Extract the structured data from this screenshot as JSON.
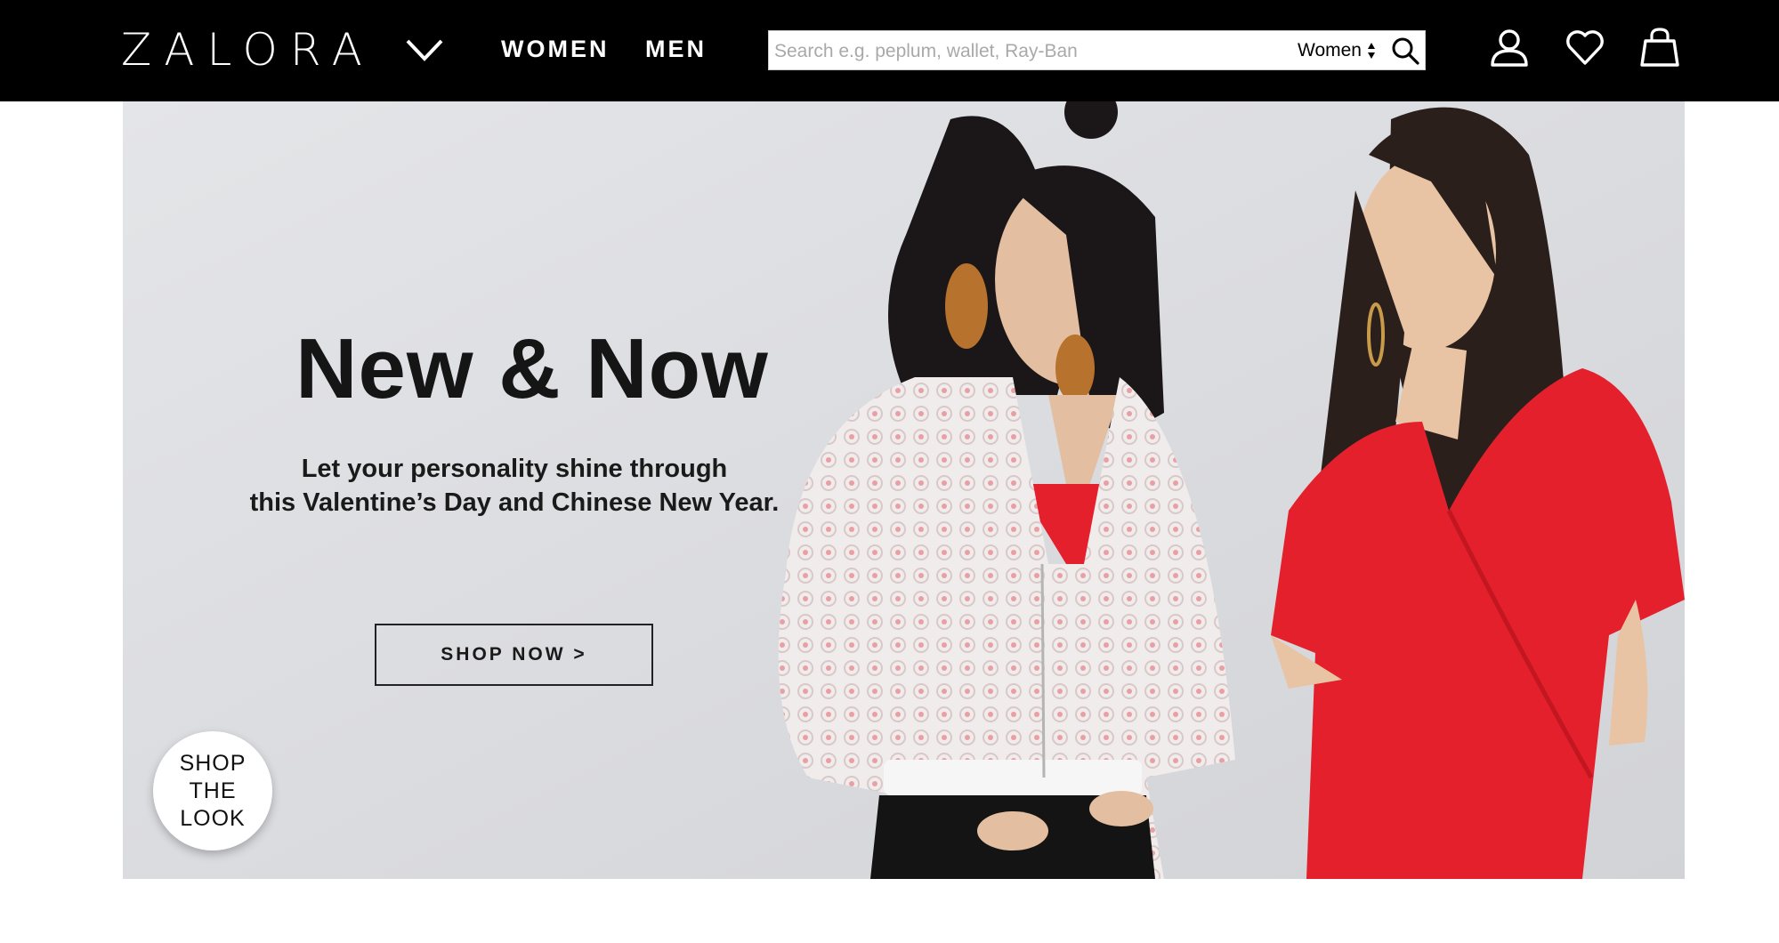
{
  "header": {
    "logo_text": "ZALORA",
    "nav": [
      {
        "label": "WOMEN"
      },
      {
        "label": "MEN"
      }
    ],
    "search": {
      "placeholder": "Search e.g. peplum, wallet, Ray-Ban",
      "value": "",
      "category_selected": "Women"
    },
    "icons": {
      "menu_chevron": "chevron-down-icon",
      "search": "search-icon",
      "account": "user-icon",
      "wishlist": "heart-icon",
      "cart": "shopping-bag-icon"
    }
  },
  "hero": {
    "title": "New & Now",
    "subtitle_lines": [
      "Let your personality shine through",
      "this Valentine’s Day and Chinese New Year."
    ],
    "cta_label": "SHOP NOW >",
    "shop_the_look_lines": [
      "SHOP",
      "THE",
      "LOOK"
    ]
  },
  "colors": {
    "header_bg": "#000000",
    "hero_bg": "#dedfe2",
    "accent_red": "#e3202b",
    "text_dark": "#151515"
  }
}
